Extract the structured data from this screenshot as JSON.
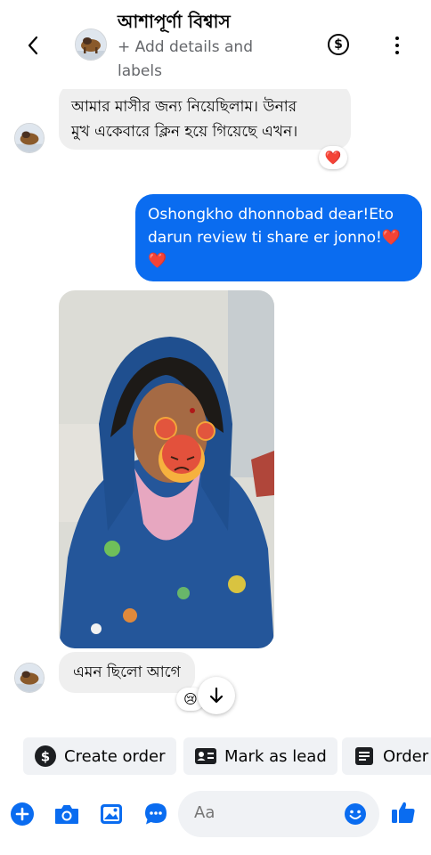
{
  "header": {
    "contact_name": "আশাপূর্ণা বিশ্বাস",
    "subtitle": "+ Add details and labels",
    "dollar_glyph": "$",
    "icons": [
      "back-arrow-icon",
      "dollar-icon",
      "more-vertical-icon"
    ]
  },
  "messages": [
    {
      "direction": "incoming",
      "lines": [
        "আমার মাসীর জন্য নিয়েছিলাম। উনার",
        "মুখ একেবারে ক্লিন হয়ে গিয়েছে এখন।"
      ],
      "reaction": "❤️"
    },
    {
      "direction": "outgoing",
      "text": "Oshongkho dhonnobad dear!Eto darun review ti share er jonno!❤️ ❤️"
    },
    {
      "direction": "incoming",
      "type": "photo"
    },
    {
      "direction": "incoming",
      "text": "এমন ছিলো আগে",
      "reaction": "😢"
    }
  ],
  "quick_actions": [
    {
      "label": "Create order",
      "icon": "dollar-circle-icon"
    },
    {
      "label": "Mark as lead",
      "icon": "contact-card-icon"
    },
    {
      "label": "Order",
      "icon": "receipt-icon"
    }
  ],
  "composer": {
    "placeholder": "Aa",
    "icons": [
      "plus-icon",
      "camera-icon",
      "gallery-icon",
      "chat-bubble-icon",
      "emoji-icon",
      "thumbs-up-icon"
    ]
  },
  "colors": {
    "accent": "#0a6cf0",
    "incoming_bubble": "#efefef",
    "outgoing_bubble": "#0a6cf0",
    "chip_bg": "#f0f2f5"
  }
}
